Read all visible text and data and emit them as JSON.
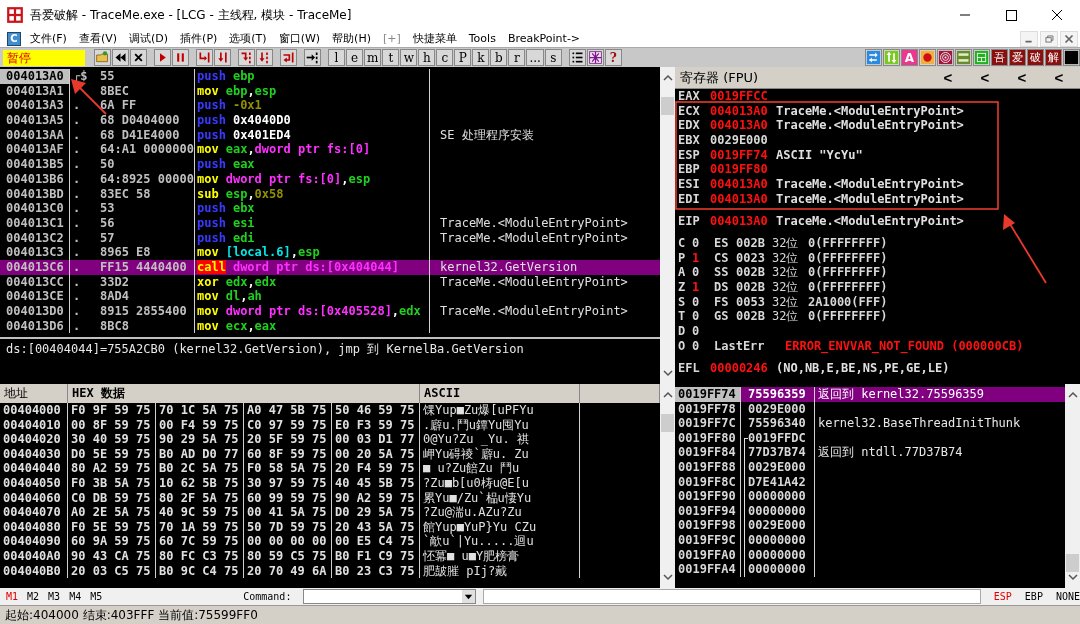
{
  "window": {
    "title": "吾爱破解 - TraceMe.exe - [LCG -  主线程, 模块 - TraceMe]"
  },
  "menu": {
    "system_icon": "C",
    "items": [
      {
        "label": "文件(F)",
        "disabled": false
      },
      {
        "label": "查看(V)",
        "disabled": false
      },
      {
        "label": "调试(D)",
        "disabled": false
      },
      {
        "label": "插件(P)",
        "disabled": false
      },
      {
        "label": "选项(T)",
        "disabled": false
      },
      {
        "label": "窗口(W)",
        "disabled": false
      },
      {
        "label": "帮助(H)",
        "disabled": false
      },
      {
        "label": "[+]",
        "disabled": true
      },
      {
        "label": "快捷菜单",
        "disabled": false
      },
      {
        "label": "Tools",
        "disabled": false
      },
      {
        "label": "BreakPoint->",
        "disabled": false
      }
    ]
  },
  "toolbar": {
    "state": "暂停",
    "letters": [
      "l",
      "e",
      "m",
      "t",
      "w",
      "h",
      "c",
      "P",
      "k",
      "b",
      "r",
      "...",
      "s"
    ],
    "help": "?",
    "plugin_letter": "A",
    "brand": [
      "吾",
      "爱",
      "破",
      "解"
    ]
  },
  "disassembly": {
    "rows": [
      {
        "address": "004013A0",
        "current": true,
        "selected": false,
        "marker": "┌$",
        "bytes": "55",
        "tokens": [
          {
            "text": "push",
            "kind": "push"
          },
          {
            "text": "ebp",
            "kind": "reg"
          }
        ]
      },
      {
        "address": "004013A1",
        "current": false,
        "selected": false,
        "bytes": "8BEC",
        "tokens": [
          {
            "text": "mov",
            "kind": "op"
          },
          {
            "text": "ebp",
            "kind": "reg"
          },
          {
            "text": ",",
            "kind": "punct"
          },
          {
            "text": "esp",
            "kind": "reg"
          }
        ]
      },
      {
        "address": "004013A3",
        "current": false,
        "selected": false,
        "marker": ".",
        "bytes": "6A FF",
        "tokens": [
          {
            "text": "push",
            "kind": "push"
          },
          {
            "text": "-0x1",
            "kind": "const"
          }
        ]
      },
      {
        "address": "004013A5",
        "current": false,
        "selected": false,
        "marker": ".",
        "bytes": "68 D0404000",
        "tokens": [
          {
            "text": "push",
            "kind": "push"
          },
          {
            "text": "0x4040D0",
            "kind": "imm"
          }
        ]
      },
      {
        "address": "004013AA",
        "current": false,
        "selected": false,
        "marker": ".",
        "bytes": "68 D41E4000",
        "tokens": [
          {
            "text": "push",
            "kind": "push"
          },
          {
            "text": "0x401ED4",
            "kind": "imm"
          }
        ],
        "comment": "SE 处理程序安装"
      },
      {
        "address": "004013AF",
        "current": false,
        "selected": false,
        "marker": ".",
        "bytes": "64:A1 0000000",
        "tokens": [
          {
            "text": "mov",
            "kind": "op"
          },
          {
            "text": "eax",
            "kind": "reg"
          },
          {
            "text": ",",
            "kind": "punct"
          },
          {
            "text": "dword ptr fs:[0]",
            "kind": "mem"
          }
        ]
      },
      {
        "address": "004013B5",
        "current": false,
        "selected": false,
        "marker": ".",
        "bytes": "50",
        "tokens": [
          {
            "text": "push",
            "kind": "push"
          },
          {
            "text": "eax",
            "kind": "reg"
          }
        ]
      },
      {
        "address": "004013B6",
        "current": false,
        "selected": false,
        "marker": ".",
        "bytes": "64:8925 00000",
        "tokens": [
          {
            "text": "mov",
            "kind": "op"
          },
          {
            "text": "dword ptr fs:[0]",
            "kind": "mem"
          },
          {
            "text": ",",
            "kind": "punct"
          },
          {
            "text": "esp",
            "kind": "reg"
          }
        ]
      },
      {
        "address": "004013BD",
        "current": false,
        "selected": false,
        "marker": ".",
        "bytes": "83EC 58",
        "tokens": [
          {
            "text": "sub",
            "kind": "op"
          },
          {
            "text": "esp",
            "kind": "reg"
          },
          {
            "text": ",",
            "kind": "punct"
          },
          {
            "text": "0x58",
            "kind": "const"
          }
        ]
      },
      {
        "address": "004013C0",
        "current": false,
        "selected": false,
        "marker": ".",
        "bytes": "53",
        "tokens": [
          {
            "text": "push",
            "kind": "push"
          },
          {
            "text": "ebx",
            "kind": "reg"
          }
        ]
      },
      {
        "address": "004013C1",
        "current": false,
        "selected": false,
        "marker": ".",
        "bytes": "56",
        "tokens": [
          {
            "text": "push",
            "kind": "push"
          },
          {
            "text": "esi",
            "kind": "reg"
          }
        ],
        "comment": "TraceMe.<ModuleEntryPoint>"
      },
      {
        "address": "004013C2",
        "current": false,
        "selected": false,
        "marker": ".",
        "bytes": "57",
        "tokens": [
          {
            "text": "push",
            "kind": "push"
          },
          {
            "text": "edi",
            "kind": "reg"
          }
        ],
        "comment": "TraceMe.<ModuleEntryPoint>"
      },
      {
        "address": "004013C3",
        "current": false,
        "selected": false,
        "marker": ".",
        "bytes": "8965 E8",
        "tokens": [
          {
            "text": "mov",
            "kind": "op"
          },
          {
            "text": "[local.6]",
            "kind": "local"
          },
          {
            "text": ",",
            "kind": "punct"
          },
          {
            "text": "esp",
            "kind": "reg"
          }
        ]
      },
      {
        "address": "004013C6",
        "current": false,
        "selected": true,
        "marker": ".",
        "bytes": "FF15 4440400",
        "tokens": [
          {
            "text": "call",
            "kind": "call"
          },
          {
            "text": "dword ptr ds:[0x404044]",
            "kind": "mem"
          }
        ],
        "comment": "kernel32.GetVersion"
      },
      {
        "address": "004013CC",
        "current": false,
        "selected": false,
        "marker": ".",
        "bytes": "33D2",
        "tokens": [
          {
            "text": "xor",
            "kind": "op"
          },
          {
            "text": "edx",
            "kind": "reg"
          },
          {
            "text": ",",
            "kind": "punct"
          },
          {
            "text": "edx",
            "kind": "reg"
          }
        ],
        "comment": "TraceMe.<ModuleEntryPoint>"
      },
      {
        "address": "004013CE",
        "current": false,
        "selected": false,
        "marker": ".",
        "bytes": "8AD4",
        "tokens": [
          {
            "text": "mov",
            "kind": "op"
          },
          {
            "text": "dl",
            "kind": "reg"
          },
          {
            "text": ",",
            "kind": "punct"
          },
          {
            "text": "ah",
            "kind": "reg"
          }
        ]
      },
      {
        "address": "004013D0",
        "current": false,
        "selected": false,
        "marker": ".",
        "bytes": "8915 2855400",
        "tokens": [
          {
            "text": "mov",
            "kind": "op"
          },
          {
            "text": "dword ptr ds:[0x405528]",
            "kind": "mem"
          },
          {
            "text": ",",
            "kind": "punct"
          },
          {
            "text": "edx",
            "kind": "reg"
          }
        ],
        "comment": "TraceMe.<ModuleEntryPoint>"
      },
      {
        "address": "004013D6",
        "current": false,
        "selected": false,
        "marker": ".",
        "bytes": "8BC8",
        "tokens": [
          {
            "text": "mov",
            "kind": "op"
          },
          {
            "text": "ecx",
            "kind": "reg"
          },
          {
            "text": ",",
            "kind": "punct"
          },
          {
            "text": "eax",
            "kind": "reg"
          }
        ]
      }
    ]
  },
  "info": {
    "lines": [
      "ds:[00404044]=755A2CB0 (kernel32.GetVersion), jmp 到 KernelBa.GetVersion"
    ]
  },
  "dump": {
    "columns": [
      "地址",
      "HEX 数据",
      "ASCII"
    ],
    "rows": [
      {
        "address": "00404000",
        "hex": [
          "F0 9F 59 75",
          "70 1C 5A 75",
          "A0 47 5B 75",
          "50 46 59 75"
        ],
        "ascii": "馃Yup■Zu爆[uPFYu"
      },
      {
        "address": "00404010",
        "hex": [
          "00 8F 59 75",
          "00 F4 59 75",
          "C0 97 59 75",
          "E0 F3 59 75"
        ],
        "ascii": ".廦u.鬥u鐔Yu囤Yu"
      },
      {
        "address": "00404020",
        "hex": [
          "30 40 59 75",
          "90 29 5A 75",
          "20 5F 59 75",
          "00 03 D1 77"
        ],
        "ascii": "0@Yu?Zu _Yu. 祺"
      },
      {
        "address": "00404030",
        "hex": [
          "D0 5E 59 75",
          "B0 AD D0 77",
          "60 8F 59 75",
          "00 20 5A 75"
        ],
        "ascii": "岬Yu碍祾`廦u. Zu"
      },
      {
        "address": "00404040",
        "hex": [
          "80 A2 59 75",
          "B0 2C 5A 75",
          "F0 58 5A 75",
          "20 F4 59 75"
        ],
        "ascii": "■  u?Zu餢Zu 鬥u"
      },
      {
        "address": "00404050",
        "hex": [
          "F0 3B 5A 75",
          "10 62 5B 75",
          "30 97 59 75",
          "40 45 5B 75"
        ],
        "ascii": "?Zu■b[u0梼u@E[u"
      },
      {
        "address": "00404060",
        "hex": [
          "C0 DB 59 75",
          "80 2F 5A 75",
          "60 99 59 75",
          "90 A2 59 75"
        ],
        "ascii": "累Yu■/Zu`榀u悽Yu"
      },
      {
        "address": "00404070",
        "hex": [
          "A0 2E 5A 75",
          "40 9C 59 75",
          "00 41 5A 75",
          "D0 29 5A 75"
        ],
        "ascii": "?Zu@湍u.AZu?Zu"
      },
      {
        "address": "00404080",
        "hex": [
          "F0 5E 59 75",
          "70 1A 59 75",
          "50 7D 59 75",
          "20 43 5A 75"
        ],
        "ascii": "館Yup■YuP}Yu CZu"
      },
      {
        "address": "00404090",
        "hex": [
          "60 9A 59 75",
          "60 7C 59 75",
          "00 00 00 00",
          "00 E5 C4 75"
        ],
        "ascii": "`歒u`|Yu.....迴u"
      },
      {
        "address": "004040A0",
        "hex": [
          "90 43 CA 75",
          "80 FC C3 75",
          "80 59 C5 75",
          "B0 F1 C9 75"
        ],
        "ascii": "怌冪■  u■Y肥榜膏"
      },
      {
        "address": "004040B0",
        "hex": [
          "20 03 C5 75",
          "B0 9C C4 75",
          "20 70 49 6A",
          "B0 23 C3 75"
        ],
        "ascii": " 肥皷膗 pIj?戴"
      }
    ]
  },
  "registers": {
    "title": "寄存器 (FPU)",
    "arrows": [
      "<",
      "<",
      "<",
      "<"
    ],
    "general": [
      {
        "name": "EAX",
        "value": "0019FFCC",
        "changed": true
      },
      {
        "name": "ECX",
        "value": "004013A0",
        "changed": true,
        "comment": "TraceMe.<ModuleEntryPoint>"
      },
      {
        "name": "EDX",
        "value": "004013A0",
        "changed": true,
        "comment": "TraceMe.<ModuleEntryPoint>"
      },
      {
        "name": "EBX",
        "value": "0029E000",
        "changed": false
      },
      {
        "name": "ESP",
        "value": "0019FF74",
        "changed": true,
        "comment": "ASCII \"YcYu\""
      },
      {
        "name": "EBP",
        "value": "0019FF80",
        "changed": true
      },
      {
        "name": "ESI",
        "value": "004013A0",
        "changed": true,
        "comment": "TraceMe.<ModuleEntryPoint>"
      },
      {
        "name": "EDI",
        "value": "004013A0",
        "changed": true,
        "comment": "TraceMe.<ModuleEntryPoint>"
      }
    ],
    "eip": {
      "name": "EIP",
      "value": "004013A0",
      "changed": true,
      "comment": "TraceMe.<ModuleEntryPoint>"
    },
    "flags": [
      {
        "name": "C",
        "value": "0",
        "changed": false,
        "segment": "ES",
        "selector": "002B",
        "bits": "32位",
        "limit": "0(FFFFFFFF)"
      },
      {
        "name": "P",
        "value": "1",
        "changed": true,
        "segment": "CS",
        "selector": "0023",
        "bits": "32位",
        "limit": "0(FFFFFFFF)"
      },
      {
        "name": "A",
        "value": "0",
        "changed": false,
        "segment": "SS",
        "selector": "002B",
        "bits": "32位",
        "limit": "0(FFFFFFFF)"
      },
      {
        "name": "Z",
        "value": "1",
        "changed": true,
        "segment": "DS",
        "selector": "002B",
        "bits": "32位",
        "limit": "0(FFFFFFFF)"
      },
      {
        "name": "S",
        "value": "0",
        "changed": false,
        "segment": "FS",
        "selector": "0053",
        "bits": "32位",
        "limit": "2A1000(FFF)"
      },
      {
        "name": "T",
        "value": "0",
        "changed": false,
        "segment": "GS",
        "selector": "002B",
        "bits": "32位",
        "limit": "0(FFFFFFFF)"
      },
      {
        "name": "D",
        "value": "0",
        "changed": false
      },
      {
        "name": "O",
        "value": "0",
        "changed": false,
        "last_error_label": "LastErr",
        "last_error": "ERROR_ENVVAR_NOT_FOUND (000000CB)"
      }
    ],
    "efl": {
      "name": "EFL",
      "value": "00000246",
      "changed": true,
      "comment": "(NO,NB,E,BE,NS,PE,GE,LE)"
    }
  },
  "stack": {
    "rows": [
      {
        "address": "0019FF74",
        "value": "75596359",
        "comment": "返回到 kernel32.75596359",
        "selected": true,
        "in_frame": false
      },
      {
        "address": "0019FF78",
        "value": "0029E000",
        "selected": false,
        "in_frame": false
      },
      {
        "address": "0019FF7C",
        "value": "75596340",
        "comment": "kernel32.BaseThreadInitThunk",
        "selected": false,
        "in_frame": false
      },
      {
        "address": "0019FF80",
        "value": "0019FFDC",
        "selected": false,
        "in_frame": true
      },
      {
        "address": "0019FF84",
        "value": "77D37B74",
        "comment": "返回到 ntdll.77D37B74",
        "selected": false,
        "in_frame": true
      },
      {
        "address": "0019FF88",
        "value": "0029E000",
        "selected": false,
        "in_frame": true
      },
      {
        "address": "0019FF8C",
        "value": "D7E41A42",
        "selected": false,
        "in_frame": true
      },
      {
        "address": "0019FF90",
        "value": "00000000",
        "selected": false,
        "in_frame": true
      },
      {
        "address": "0019FF94",
        "value": "00000000",
        "selected": false,
        "in_frame": true
      },
      {
        "address": "0019FF98",
        "value": "0029E000",
        "selected": false,
        "in_frame": true
      },
      {
        "address": "0019FF9C",
        "value": "00000000",
        "selected": false,
        "in_frame": true
      },
      {
        "address": "0019FFA0",
        "value": "00000000",
        "selected": false,
        "in_frame": true
      },
      {
        "address": "0019FFA4",
        "value": "00000000",
        "selected": false,
        "in_frame": true
      }
    ]
  },
  "command_bar": {
    "tabs": [
      {
        "label": "M1",
        "selected": true
      },
      {
        "label": "M2",
        "selected": false
      },
      {
        "label": "M3",
        "selected": false
      },
      {
        "label": "M4",
        "selected": false
      },
      {
        "label": "M5",
        "selected": false
      }
    ],
    "command_label": "Command:"
  },
  "stack_modes": [
    {
      "label": "ESP",
      "selected": true
    },
    {
      "label": "EBP",
      "selected": false
    },
    {
      "label": "NONE",
      "selected": false
    }
  ],
  "status_bar": "起始:404000 结束:403FFF 当前值:75599FF0"
}
